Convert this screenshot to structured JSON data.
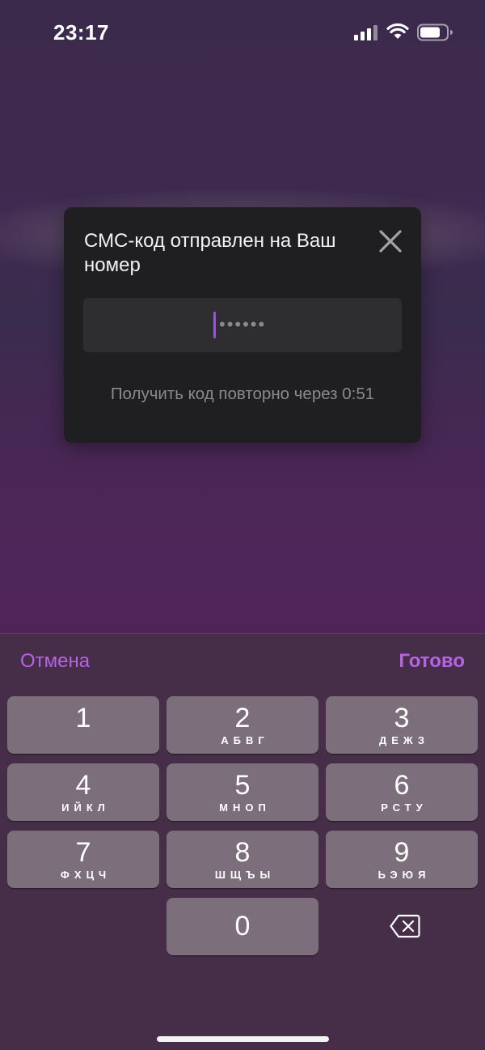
{
  "status_bar": {
    "time": "23:17",
    "icons": [
      "signal-icon",
      "wifi-icon",
      "battery-icon"
    ]
  },
  "dialog": {
    "title": "СМС-код отправлен на Ваш номер",
    "code_placeholder": "••••••",
    "resend_text": "Получить код повторно через 0:51",
    "close_icon": "close-icon"
  },
  "keyboard": {
    "cancel_label": "Отмена",
    "done_label": "Готово",
    "keys": [
      {
        "digit": "1",
        "letters": ""
      },
      {
        "digit": "2",
        "letters": "АБВГ"
      },
      {
        "digit": "3",
        "letters": "ДЕЖЗ"
      },
      {
        "digit": "4",
        "letters": "ИЙКЛ"
      },
      {
        "digit": "5",
        "letters": "МНОП"
      },
      {
        "digit": "6",
        "letters": "РСТУ"
      },
      {
        "digit": "7",
        "letters": "ФХЦЧ"
      },
      {
        "digit": "8",
        "letters": "ШЩЪЫ"
      },
      {
        "digit": "9",
        "letters": "ЬЭЮЯ"
      },
      {
        "digit": "0",
        "letters": ""
      }
    ],
    "backspace_icon": "backspace-icon"
  },
  "colors": {
    "accent": "#b564e2",
    "dialog_bg": "#1f1f21",
    "key_bg": "#7d6e7c",
    "keyboard_bg": "#462e48"
  }
}
